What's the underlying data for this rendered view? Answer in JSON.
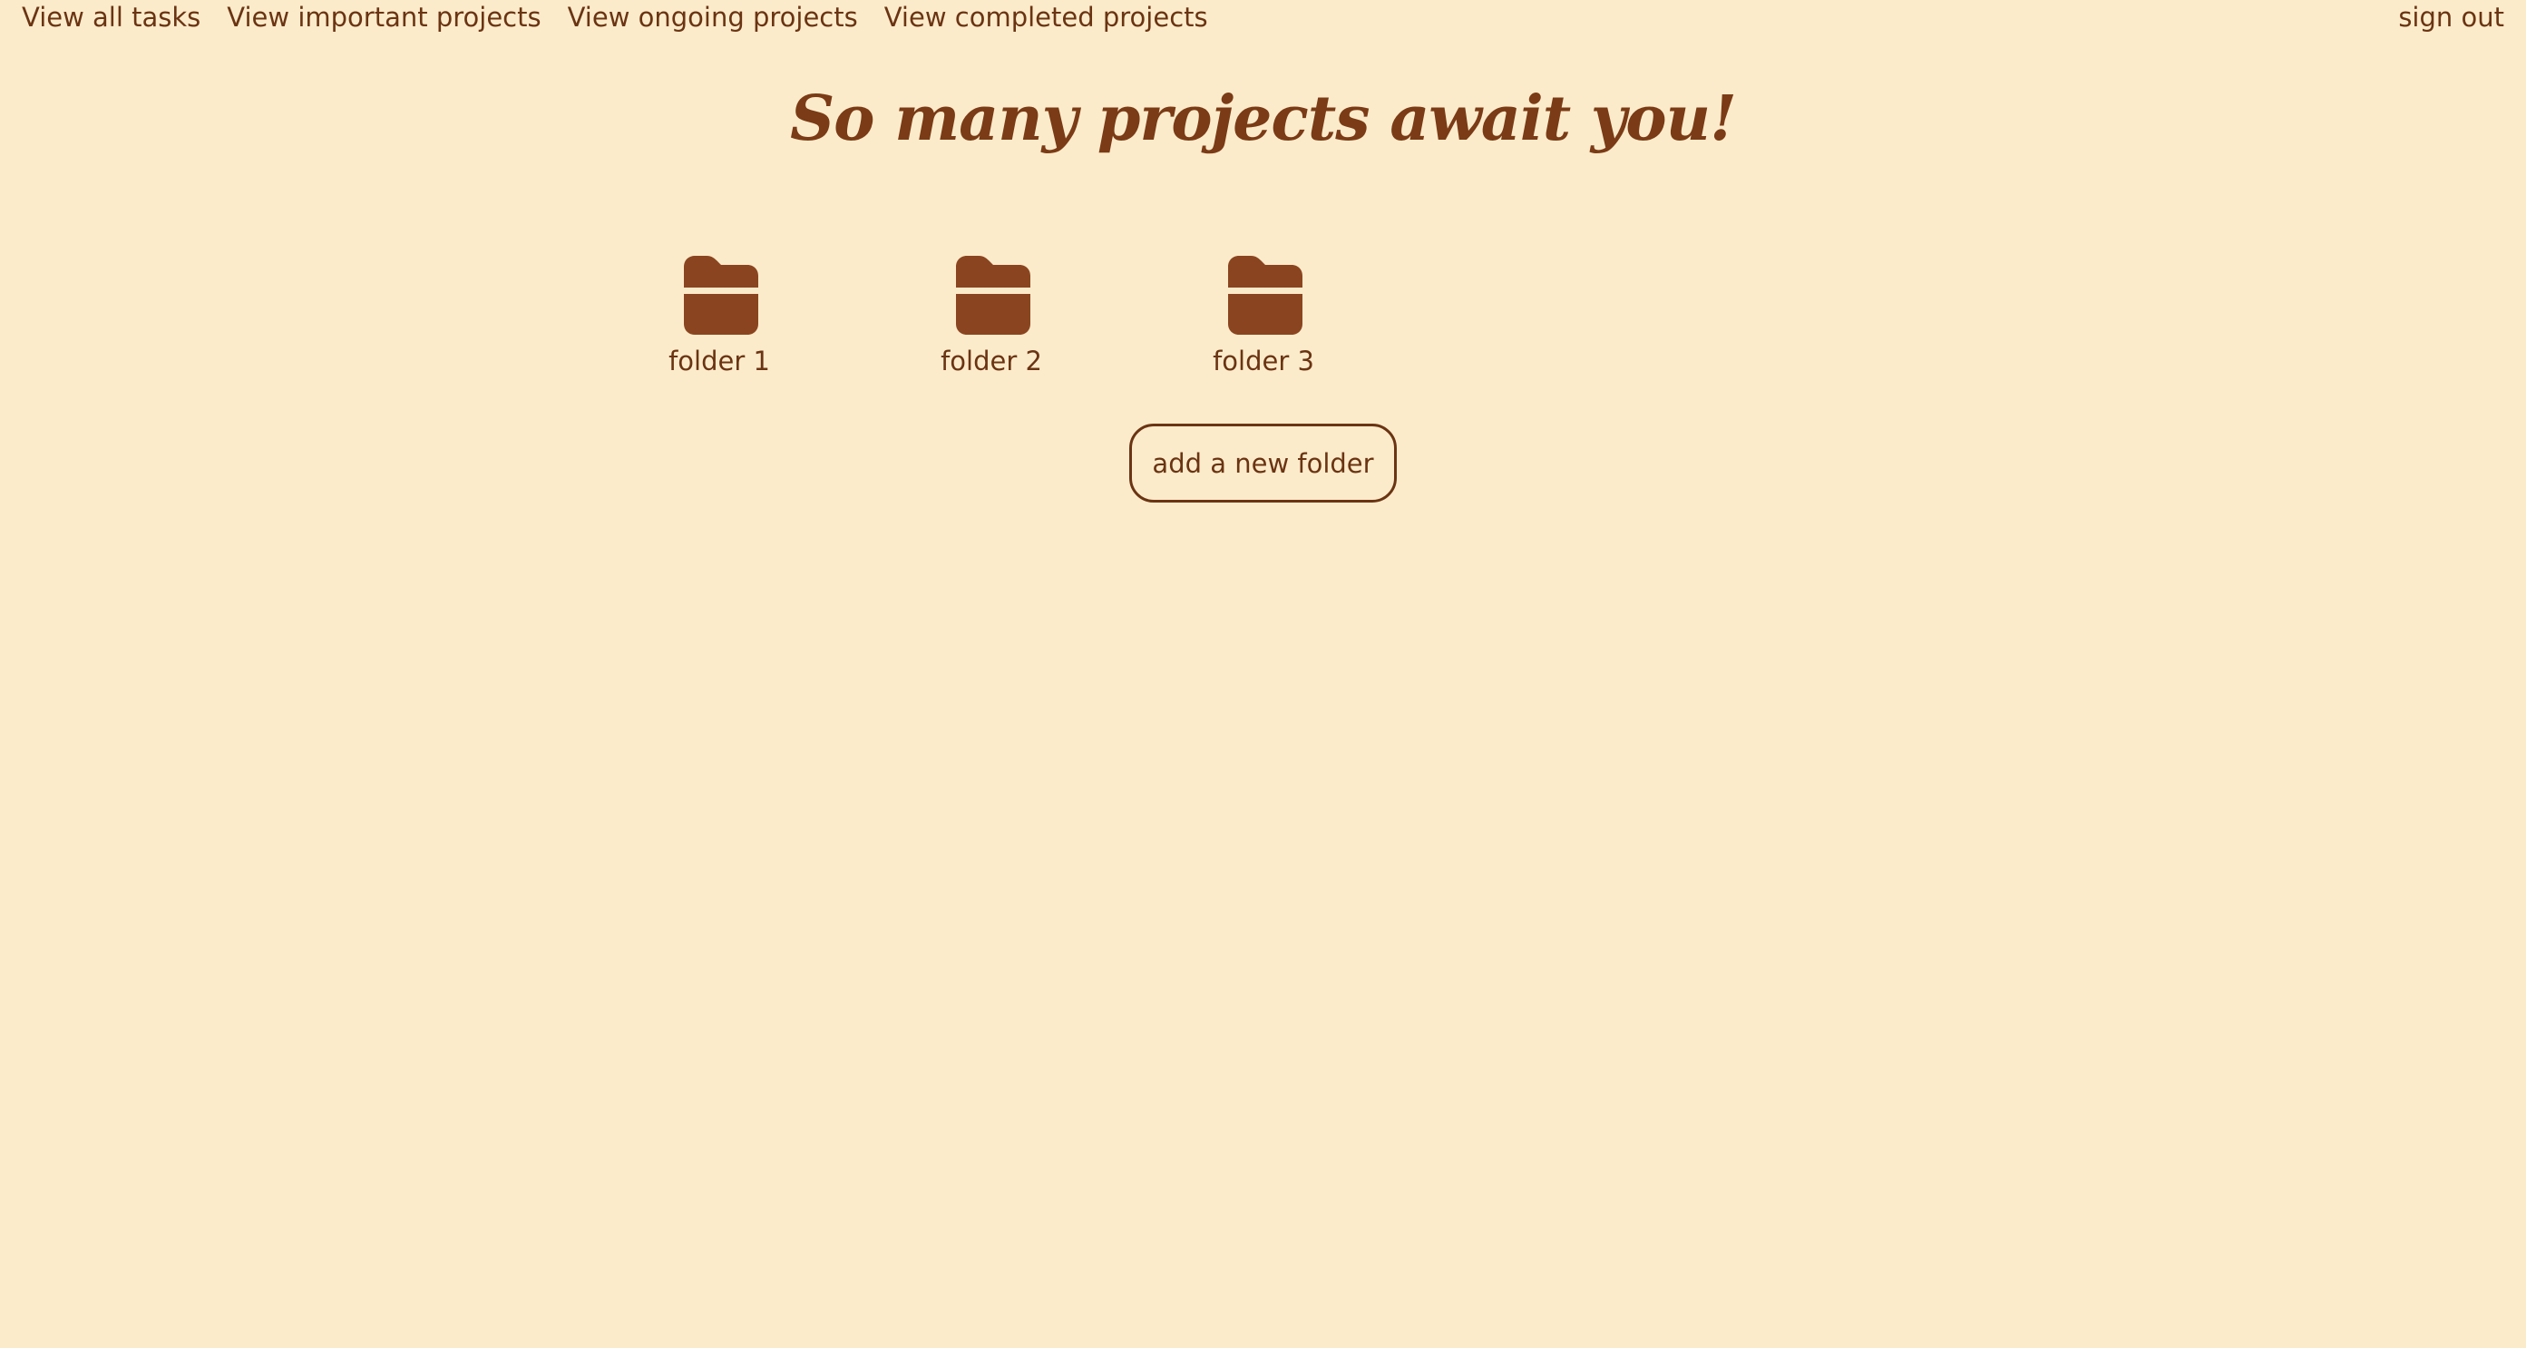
{
  "nav": {
    "links": [
      "View all tasks",
      "View important projects",
      "View ongoing projects",
      "View completed projects"
    ],
    "sign_out": "sign out"
  },
  "page": {
    "title": "So many projects await you!"
  },
  "folders": [
    {
      "label": "folder 1",
      "icon": "folder-icon"
    },
    {
      "label": "folder 2",
      "icon": "folder-icon"
    },
    {
      "label": "folder 3",
      "icon": "folder-icon"
    }
  ],
  "actions": {
    "add_folder": "add a new folder"
  },
  "colors": {
    "background": "#fcebca",
    "text": "#6a3413",
    "folder": "#8a4520",
    "title": "#7a3b16"
  }
}
